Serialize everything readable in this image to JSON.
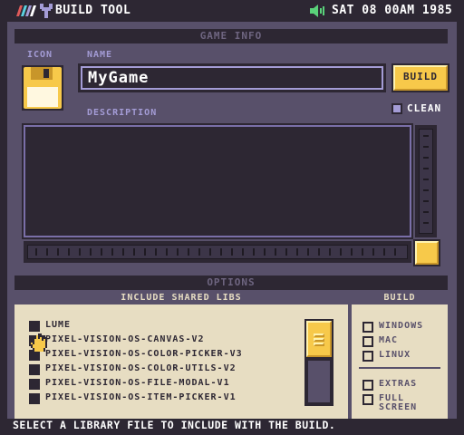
{
  "top_bar": {
    "title": "BUILD TOOL",
    "clock": "SAT 08 00AM 1985",
    "icons": [
      "logo-stripes-icon",
      "tool-icon",
      "speaker-icon"
    ]
  },
  "game_info": {
    "section_title": "GAME INFO",
    "icon_label": "ICON",
    "name_label": "NAME",
    "name_value": "MyGame",
    "build_button": "BUILD",
    "clean_label": "CLEAN",
    "description_label": "DESCRIPTION"
  },
  "options": {
    "section_title": "OPTIONS",
    "libs_title": "INCLUDE SHARED LIBS",
    "libs": [
      "LUME",
      "PIXEL-VISION-OS-CANVAS-V2",
      "PIXEL-VISION-OS-COLOR-PICKER-V3",
      "PIXEL-VISION-OS-COLOR-UTILS-V2",
      "PIXEL-VISION-OS-FILE-MODAL-V1",
      "PIXEL-VISION-OS-ITEM-PICKER-V1"
    ],
    "build_title": "BUILD",
    "platforms": [
      "WINDOWS",
      "MAC",
      "LINUX"
    ],
    "extras": [
      "EXTRAS",
      "FULL",
      "SCREEN"
    ]
  },
  "status_bar": {
    "message": "SELECT A LIBRARY FILE TO INCLUDE WITH THE BUILD."
  },
  "colors": {
    "background": "#2d2733",
    "panel": "#58506a",
    "accent_yellow": "#f7c94a",
    "label_purple": "#a49cd6",
    "panel_light": "#e7ddc2"
  }
}
